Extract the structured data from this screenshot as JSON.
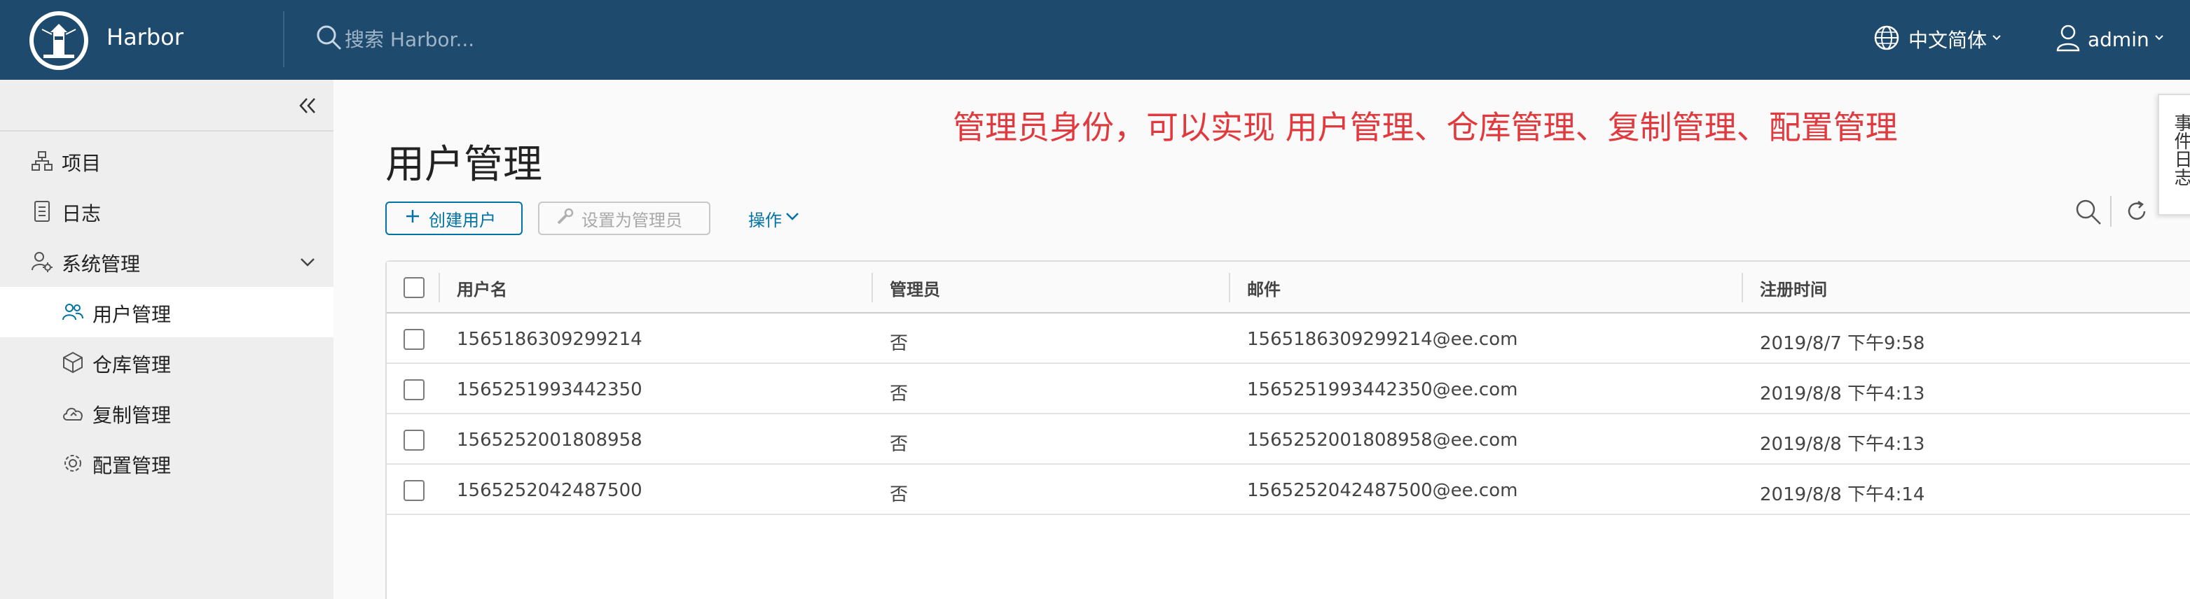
{
  "header": {
    "brand": "Harbor",
    "search_placeholder": "搜索 Harbor...",
    "language": "中文简体",
    "user": "admin"
  },
  "sidebar": {
    "items": [
      {
        "label": "项目",
        "icon": "projects-icon"
      },
      {
        "label": "日志",
        "icon": "logs-icon"
      },
      {
        "label": "系统管理",
        "icon": "admin-icon",
        "expanded": true
      },
      {
        "label": "用户管理",
        "icon": "users-icon",
        "active": true
      },
      {
        "label": "仓库管理",
        "icon": "registry-icon"
      },
      {
        "label": "复制管理",
        "icon": "replication-icon"
      },
      {
        "label": "配置管理",
        "icon": "settings-icon"
      }
    ]
  },
  "main": {
    "annotation": "管理员身份，可以实现 用户管理、仓库管理、复制管理、配置管理",
    "title": "用户管理",
    "buttons": {
      "create": "创建用户",
      "set_admin": "设置为管理员",
      "action": "操作"
    },
    "event_log": "事件日志",
    "table": {
      "columns": [
        "用户名",
        "管理员",
        "邮件",
        "注册时间"
      ],
      "rows": [
        {
          "username": "1565186309299214",
          "admin": "否",
          "email": "1565186309299214@ee.com",
          "registered": "2019/8/7 下午9:58"
        },
        {
          "username": "1565251993442350",
          "admin": "否",
          "email": "1565251993442350@ee.com",
          "registered": "2019/8/8 下午4:13"
        },
        {
          "username": "1565252001808958",
          "admin": "否",
          "email": "1565252001808958@ee.com",
          "registered": "2019/8/8 下午4:13"
        },
        {
          "username": "1565252042487500",
          "admin": "否",
          "email": "1565252042487500@ee.com",
          "registered": "2019/8/8 下午4:14"
        }
      ]
    }
  },
  "colors": {
    "header_bg": "#1e4a6d",
    "accent": "#0072a3",
    "annotation": "#e0393e",
    "sidebar_bg": "#eeeeee"
  }
}
